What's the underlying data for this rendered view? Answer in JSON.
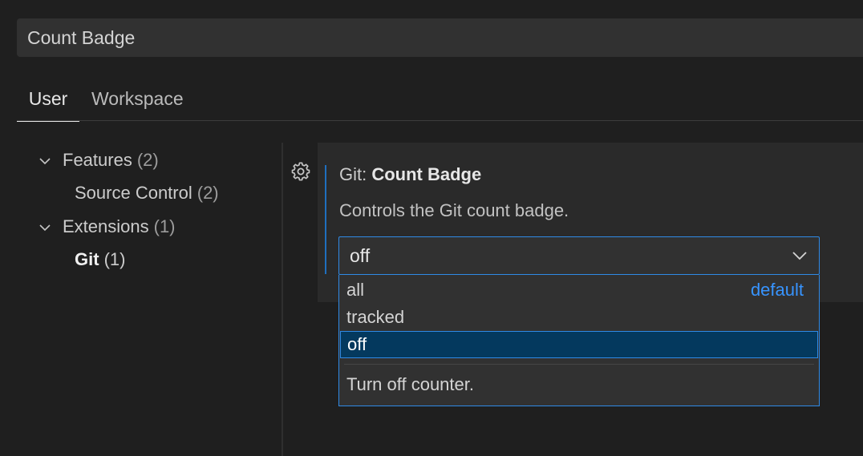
{
  "search": {
    "value": "Count Badge"
  },
  "tabs": [
    {
      "label": "User",
      "active": true
    },
    {
      "label": "Workspace",
      "active": false
    }
  ],
  "toc": {
    "items": [
      {
        "label": "Features",
        "count": "(2)",
        "expanded": true
      },
      {
        "label": "Source Control",
        "count": "(2)"
      },
      {
        "label": "Extensions",
        "count": "(1)",
        "expanded": true
      },
      {
        "label": "Git",
        "count": "(1)",
        "selected": true
      }
    ]
  },
  "setting": {
    "category": "Git: ",
    "name": "Count Badge",
    "description": "Controls the Git count badge.",
    "value": "off",
    "options": [
      {
        "label": "all",
        "tag": "default"
      },
      {
        "label": "tracked"
      },
      {
        "label": "off",
        "highlighted": true
      }
    ],
    "option_description": "Turn off counter."
  },
  "colors": {
    "background": "#1f1f1f",
    "accent": "#2f8ae6",
    "link": "#3794ff",
    "highlight": "#04395e"
  },
  "icons": {
    "gear": "gear-icon",
    "chevron": "chevron-down-icon"
  }
}
